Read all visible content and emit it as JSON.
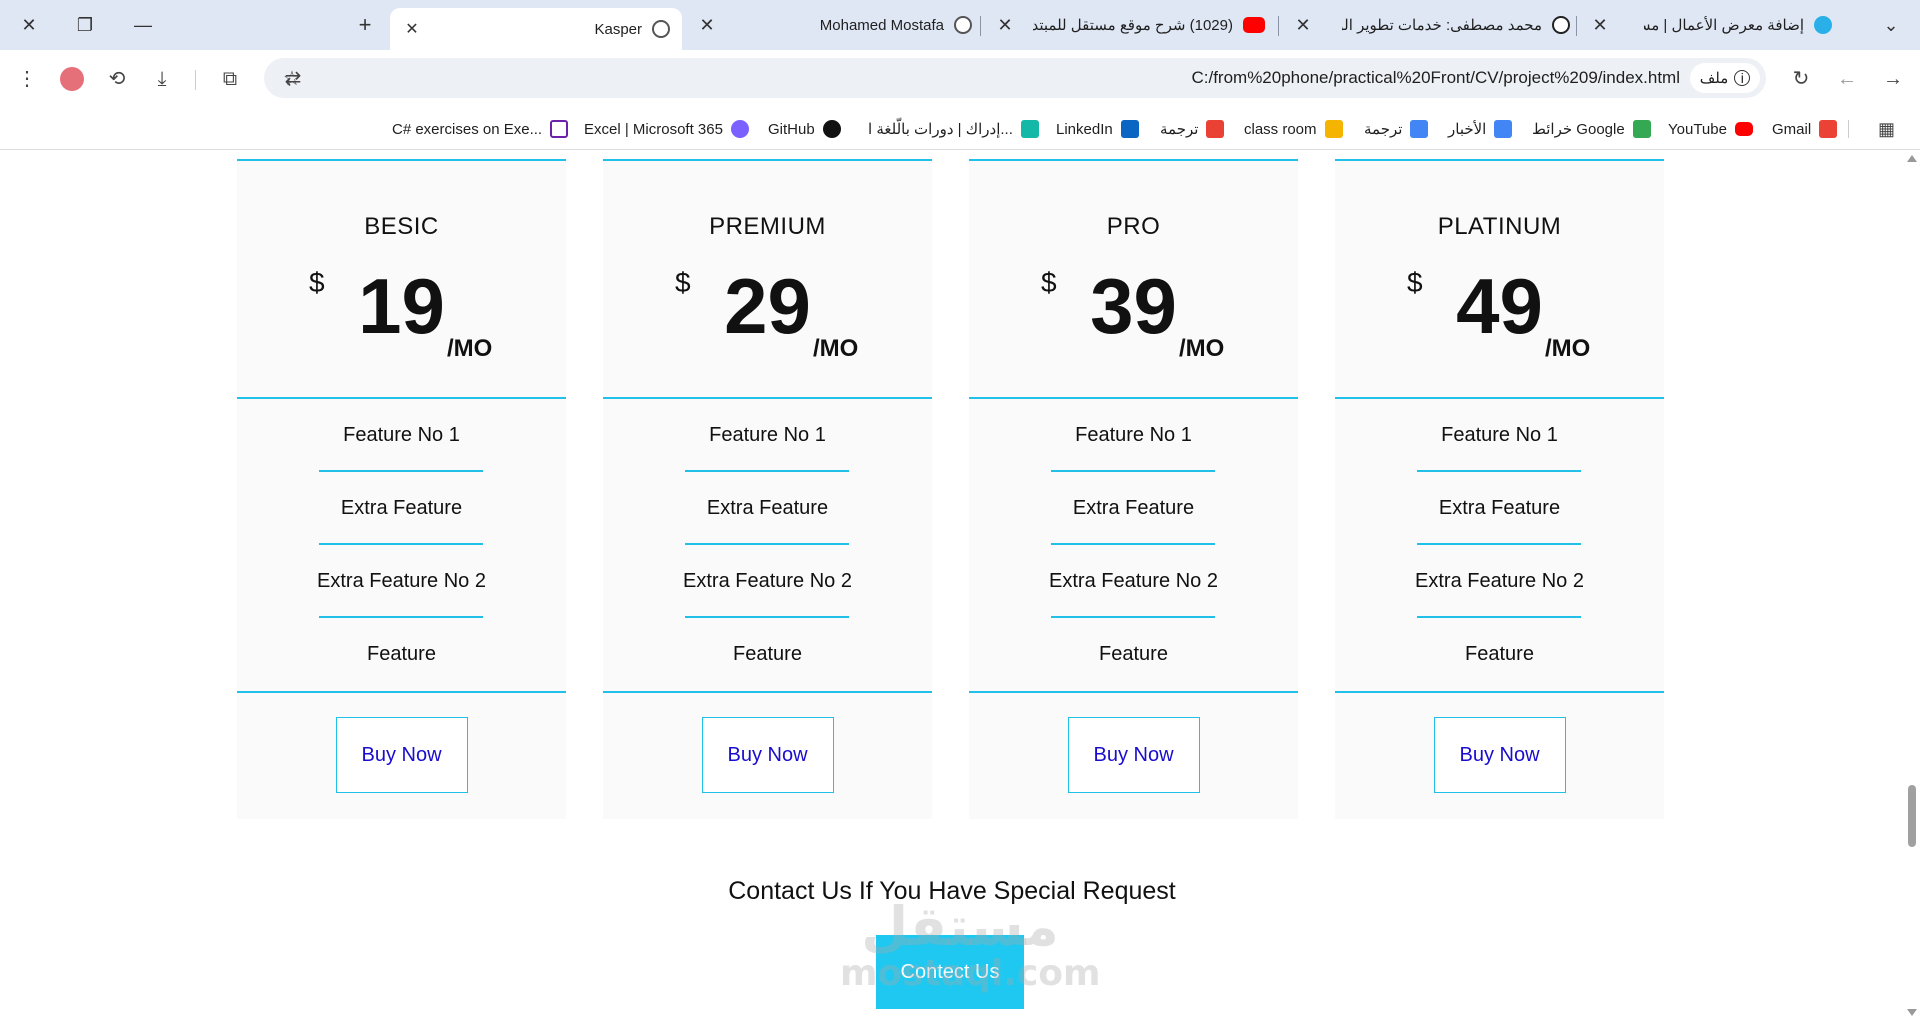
{
  "browser": {
    "tabs": [
      {
        "title": "إضافة معرض الأعمال | مستقل",
        "icon": "mostaql-icon",
        "color": "#2ab0e8"
      },
      {
        "title": "محمد مصطفى: خدمات تطوير الو",
        "icon": "khamsat-icon",
        "color": "#222222"
      },
      {
        "title": "(1029) شرح موقع مستقل للمبتد",
        "icon": "youtube-icon",
        "color": "#ff0000"
      },
      {
        "title": "Mohamed Mostafa",
        "icon": "globe-icon",
        "color": "#555555"
      },
      {
        "title": "Kasper",
        "icon": "globe-icon",
        "color": "#555555"
      }
    ],
    "new_tab_label": "+",
    "url": "C:/from%20phone/practical%20Front/CV/project%209/index.html",
    "site_chip_label": "ملف",
    "bookmarks": [
      {
        "label": "Gmail",
        "icon": "gmail-icon",
        "color": "#ea4335"
      },
      {
        "label": "YouTube",
        "icon": "youtube-icon",
        "color": "#ff0000"
      },
      {
        "label": "خرائط Google",
        "icon": "maps-icon",
        "color": "#34a853"
      },
      {
        "label": "الأخبار",
        "icon": "news-icon",
        "color": "#4285f4"
      },
      {
        "label": "ترجمة",
        "icon": "translate-icon",
        "color": "#4285f4"
      },
      {
        "label": "class room",
        "icon": "classroom-icon",
        "color": "#f4b400"
      },
      {
        "label": "ترجمة",
        "icon": "translate-pdf-icon",
        "color": "#e94235"
      },
      {
        "label": "LinkedIn",
        "icon": "linkedin-icon",
        "color": "#0a66c2"
      },
      {
        "label": "إدراك | دورات بالّلغة ا...",
        "icon": "edraak-icon",
        "color": "#14b8a6"
      },
      {
        "label": "GitHub",
        "icon": "github-icon",
        "color": "#111111"
      },
      {
        "label": "Excel | Microsoft 365",
        "icon": "m365-icon",
        "color": "#7b61ff"
      },
      {
        "label": "C# exercises on Exe...",
        "icon": "exercism-icon",
        "color": "#6b21a8"
      }
    ]
  },
  "plans": [
    {
      "name": "BESIC",
      "currency": "$",
      "price": "19",
      "period": "/MO",
      "features": [
        "Feature No 1",
        "Extra Feature",
        "Extra Feature No 2",
        "Feature"
      ],
      "button": "Buy Now"
    },
    {
      "name": "PREMIUM",
      "currency": "$",
      "price": "29",
      "period": "/MO",
      "features": [
        "Feature No 1",
        "Extra Feature",
        "Extra Feature No 2",
        "Feature"
      ],
      "button": "Buy Now"
    },
    {
      "name": "PRO",
      "currency": "$",
      "price": "39",
      "period": "/MO",
      "features": [
        "Feature No 1",
        "Extra Feature",
        "Extra Feature No 2",
        "Feature"
      ],
      "button": "Buy Now"
    },
    {
      "name": "PLATINUM",
      "currency": "$",
      "price": "49",
      "period": "/MO",
      "features": [
        "Feature No 1",
        "Extra Feature",
        "Extra Feature No 2",
        "Feature"
      ],
      "button": "Buy Now"
    }
  ],
  "contact": {
    "title": "Contact Us If You Have Special Request",
    "button": "Contect Us"
  },
  "watermark": {
    "arabic": "مستقل",
    "latin": "mostaql.com"
  },
  "colors": {
    "accent": "#20c0e8",
    "button_bg": "#1ec8f0",
    "link": "#1a0dcc",
    "card_bg": "#fafafa"
  }
}
